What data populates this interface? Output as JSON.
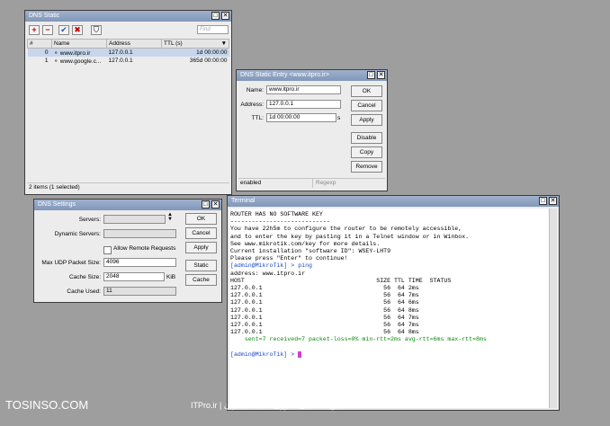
{
  "dns_static": {
    "title": "DNS Static",
    "find_placeholder": "Find",
    "toolbar": {
      "add": "+",
      "remove": "−",
      "enable": "✔",
      "disable": "✖",
      "filter": "⛉"
    },
    "columns": [
      "#",
      "Name",
      "Address",
      "TTL (s)"
    ],
    "rows": [
      {
        "num": "0",
        "name": "www.itpro.ir",
        "address": "127.0.0.1",
        "ttl": "1d 00:00:00"
      },
      {
        "num": "1",
        "name": "www.google.c...",
        "address": "127.0.0.1",
        "ttl": "365d 00:00:00"
      }
    ],
    "status": "2 items (1 selected)"
  },
  "dns_entry": {
    "title": "DNS Static Entry <www.itpro.ir>",
    "name_label": "Name:",
    "name_value": "www.itpro.ir",
    "address_label": "Address:",
    "address_value": "127.0.0.1",
    "ttl_label": "TTL:",
    "ttl_value": "1d 00:00:00",
    "ttl_unit": "s",
    "buttons": [
      "OK",
      "Cancel",
      "Apply",
      "Disable",
      "Copy",
      "Remove"
    ],
    "status_left": "enabled",
    "status_right": "Regexp"
  },
  "dns_settings": {
    "title": "DNS Settings",
    "servers_label": "Servers:",
    "dynamic_label": "Dynamic Servers:",
    "allow_remote": "Allow Remote Requests",
    "max_udp_label": "Max UDP Packet Size:",
    "max_udp_value": "4096",
    "cache_size_label": "Cache Size:",
    "cache_size_value": "2048",
    "cache_size_unit": "KiB",
    "cache_used_label": "Cache Used:",
    "cache_used_value": "11",
    "buttons": [
      "OK",
      "Cancel",
      "Apply",
      "Static",
      "Cache"
    ]
  },
  "terminal": {
    "title": "Terminal",
    "lines": [
      "",
      "",
      "ROUTER HAS NO SOFTWARE KEY",
      "----------------------------",
      "You have 22h5m to configure the router to be remotely accessible,",
      "and to enter the key by pasting it in a Telnet window or in Winbox.",
      "See www.mikrotik.com/key for more details.",
      "",
      "Current installation \"software ID\": WSEY-LHT9",
      "Please press \"Enter\" to continue!",
      ""
    ],
    "prompt1_user": "[admin@MikroTik] > ",
    "prompt1_cmd": "ping",
    "address_line": "address: www.itpro.ir",
    "ping_header": "HOST                                     SIZE TTL TIME  STATUS",
    "ping_rows": [
      "127.0.0.1                                  56  64 2ms",
      "127.0.0.1                                  56  64 7ms",
      "127.0.0.1                                  56  64 6ms",
      "127.0.0.1                                  56  64 8ms",
      "127.0.0.1                                  56  64 7ms",
      "127.0.0.1                                  56  64 7ms",
      "127.0.0.1                                  56  64 8ms"
    ],
    "summary": "    sent=7 received=7 packet-loss=0% min-rtt=2ms avg-rtt=6ms max-rtt=8ms",
    "prompt2_user": "[admin@MikroTik] > "
  },
  "watermark_left": "TOSINSO.COM",
  "watermark_right": "ITPro.ir | انجمن تخصصی فناوری اطلاعات ایران"
}
